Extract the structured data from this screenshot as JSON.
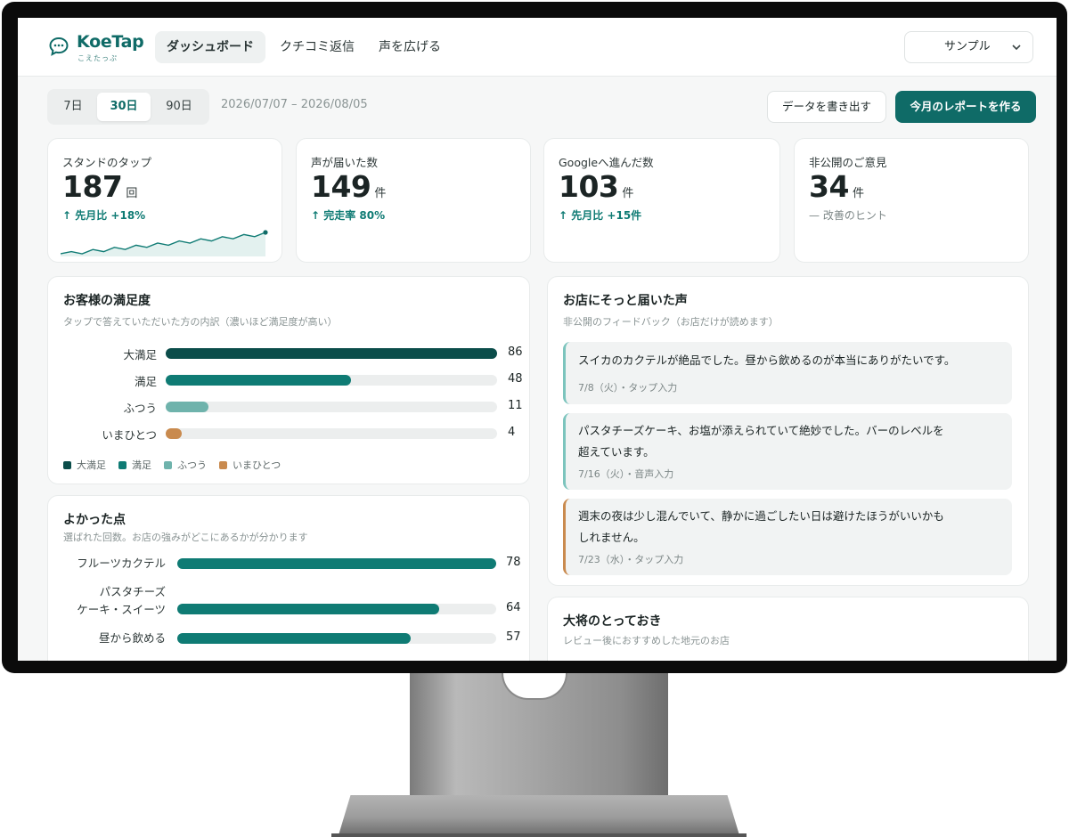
{
  "app": {
    "name": "KoeTap",
    "name_sub": "こえたっぷ"
  },
  "nav": {
    "tabs": [
      {
        "label": "ダッシュボード",
        "active": true
      },
      {
        "label": "クチコミ返信",
        "active": false
      },
      {
        "label": "声を広げる",
        "active": false
      }
    ],
    "store_select": {
      "value": "サンプル"
    }
  },
  "toolbar": {
    "periods": [
      {
        "label": "7日",
        "active": false
      },
      {
        "label": "30日",
        "active": true
      },
      {
        "label": "90日",
        "active": false
      }
    ],
    "date_range": "2026/07/07 – 2026/08/05",
    "export_label": "データを書き出す",
    "report_label": "今月のレポートを作る"
  },
  "kpis": [
    {
      "label": "スタンドのタップ",
      "value": "187",
      "unit": "回",
      "delta": "↑  先月比 +18%"
    },
    {
      "label": "声が届いた数",
      "value": "149",
      "unit": "件",
      "delta": "↑  完走率 80%"
    },
    {
      "label": "Googleへ進んだ数",
      "value": "103",
      "unit": "件",
      "delta": "↑  先月比 +15件"
    },
    {
      "label": "非公開のご意見",
      "value": "34",
      "unit": "件",
      "delta": "—  改善のヒント"
    }
  ],
  "sparkline": {
    "values": [
      5,
      6,
      5,
      7,
      6,
      8,
      7,
      9,
      8,
      10,
      9,
      11,
      10,
      12,
      11,
      13,
      12,
      14,
      13,
      15
    ]
  },
  "satisfaction": {
    "title": "お客様の満足度",
    "subtitle": "タップで答えていただいた方の内訳（濃いほど満足度が高い）",
    "max": 86,
    "rows": [
      {
        "label": "大満足",
        "value": 86,
        "color": "#0b4d4a"
      },
      {
        "label": "満足",
        "value": 48,
        "color": "#0f7b74"
      },
      {
        "label": "ふつう",
        "value": 11,
        "color": "#6fb3ac"
      },
      {
        "label": "いまひとつ",
        "value": 4,
        "color": "#c98a4e"
      }
    ],
    "legend": [
      {
        "label": "大満足",
        "color": "#0b4d4a"
      },
      {
        "label": "満足",
        "color": "#0f7b74"
      },
      {
        "label": "ふつう",
        "color": "#6fb3ac"
      },
      {
        "label": "いまひとつ",
        "color": "#c98a4e"
      }
    ]
  },
  "good_points": {
    "title": "よかった点",
    "subtitle": "選ばれた回数。お店の強みがどこにあるかが分かります",
    "max": 78,
    "rows": [
      {
        "label_lines": [
          "フルーツカクテル"
        ],
        "value": 78
      },
      {
        "label_lines": [
          "パスタチーズ",
          "ケーキ・スイーツ"
        ],
        "value": 64
      },
      {
        "label_lines": [
          "昼から飲める"
        ],
        "value": 57
      }
    ]
  },
  "feedback": {
    "title": "お店にそっと届いた声",
    "subtitle": "非公開のフィードバック（お店だけが読めます）",
    "items": [
      {
        "text": "スイカのカクテルが絶品でした。昼から飲めるのが本当にありがたいです。",
        "meta": "7/8（火）・タップ入力",
        "tone": "positive"
      },
      {
        "text": "パスタチーズケーキ、お塩が添えられていて絶妙でした。バーのレベルを超えています。",
        "meta": "7/16（火）・音声入力",
        "tone": "positive"
      },
      {
        "text": "週末の夜は少し混んでいて、静かに過ごしたい日は避けたほうがいいかもしれません。",
        "meta": "7/23（水）・タップ入力",
        "tone": "warning"
      }
    ]
  },
  "recommend": {
    "title": "大将のとっておき",
    "subtitle": "レビュー後におすすめした地元のお店"
  }
}
